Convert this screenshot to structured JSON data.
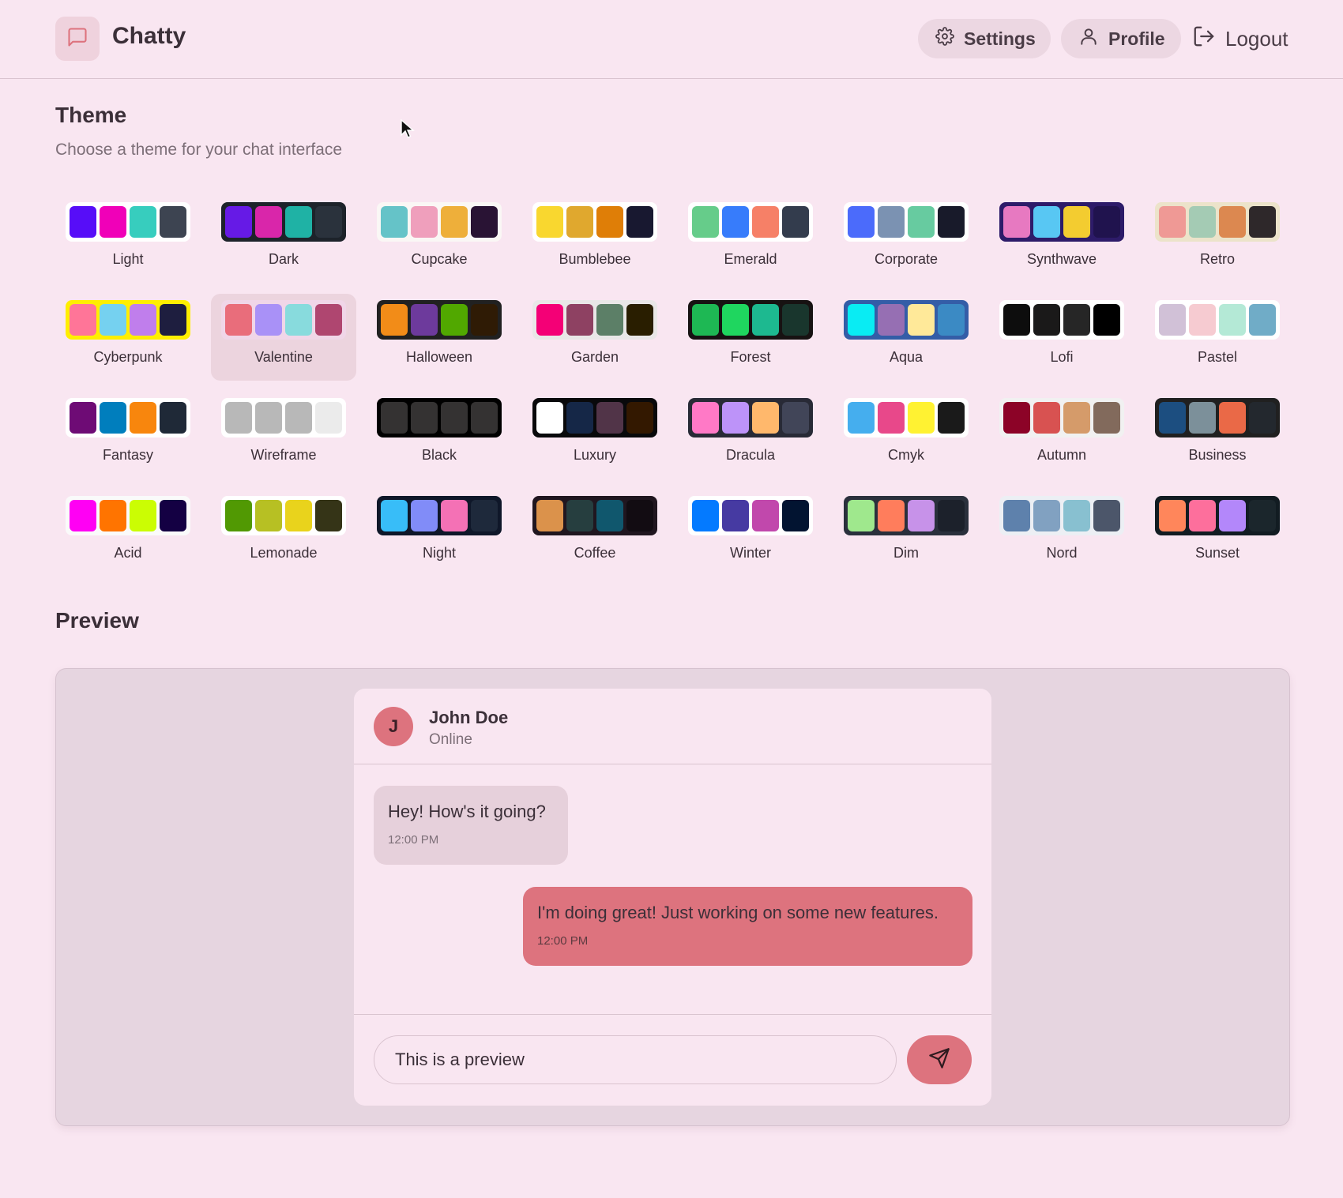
{
  "app": {
    "name": "Chatty",
    "nav": {
      "settings": "Settings",
      "profile": "Profile",
      "logout": "Logout"
    }
  },
  "theme_section": {
    "title": "Theme",
    "subtitle": "Choose a theme for your chat interface",
    "selected": "Valentine",
    "themes": [
      {
        "name": "Light",
        "frame": "#ffffff",
        "colors": [
          "#570df8",
          "#f000b8",
          "#37cdbe",
          "#3d4451"
        ]
      },
      {
        "name": "Dark",
        "frame": "#1d232a",
        "colors": [
          "#661ae6",
          "#d926aa",
          "#1fb2a5",
          "#2a323c"
        ]
      },
      {
        "name": "Cupcake",
        "frame": "#faf7f5",
        "colors": [
          "#65c3c8",
          "#ef9fbc",
          "#eeaf3a",
          "#291334"
        ]
      },
      {
        "name": "Bumblebee",
        "frame": "#ffffff",
        "colors": [
          "#f9d72f",
          "#e0a82e",
          "#df7e07",
          "#181830"
        ]
      },
      {
        "name": "Emerald",
        "frame": "#ffffff",
        "colors": [
          "#66cc8a",
          "#377cfb",
          "#f68067",
          "#333c4d"
        ]
      },
      {
        "name": "Corporate",
        "frame": "#ffffff",
        "colors": [
          "#4b6bfb",
          "#7b92b2",
          "#67cba0",
          "#181a2a"
        ]
      },
      {
        "name": "Synthwave",
        "frame": "#2d1b69",
        "colors": [
          "#e779c1",
          "#58c7f3",
          "#f3cc30",
          "#20134e"
        ]
      },
      {
        "name": "Retro",
        "frame": "#ece3ca",
        "colors": [
          "#ef9995",
          "#a4cbb4",
          "#dc8850",
          "#2e282a"
        ]
      },
      {
        "name": "Cyberpunk",
        "frame": "#ffee00",
        "colors": [
          "#ff7598",
          "#75d1f0",
          "#c07eec",
          "#1e1e3f"
        ]
      },
      {
        "name": "Valentine",
        "frame": "#f0d6e8",
        "colors": [
          "#e96d7b",
          "#a991f7",
          "#88dbdd",
          "#af4670"
        ]
      },
      {
        "name": "Halloween",
        "frame": "#212121",
        "colors": [
          "#f28c18",
          "#6d3a9c",
          "#51a800",
          "#2f1b05"
        ]
      },
      {
        "name": "Garden",
        "frame": "#e9e7e7",
        "colors": [
          "#f40076",
          "#8e4162",
          "#5c7f67",
          "#291e00"
        ]
      },
      {
        "name": "Forest",
        "frame": "#171212",
        "colors": [
          "#1eb854",
          "#1fd65f",
          "#1db990",
          "#19362d"
        ]
      },
      {
        "name": "Aqua",
        "frame": "#345da7",
        "colors": [
          "#09ecf3",
          "#966fb3",
          "#ffe999",
          "#3b8ac4"
        ]
      },
      {
        "name": "Lofi",
        "frame": "#ffffff",
        "colors": [
          "#0d0d0d",
          "#1a1919",
          "#262626",
          "#000000"
        ]
      },
      {
        "name": "Pastel",
        "frame": "#ffffff",
        "colors": [
          "#d1c1d7",
          "#f6cbd1",
          "#b4e9d6",
          "#70acc7"
        ]
      },
      {
        "name": "Fantasy",
        "frame": "#ffffff",
        "colors": [
          "#6e0b75",
          "#007ebd",
          "#f8860d",
          "#1f2937"
        ]
      },
      {
        "name": "Wireframe",
        "frame": "#ffffff",
        "colors": [
          "#b8b8b8",
          "#b8b8b8",
          "#b8b8b8",
          "#ebebeb"
        ]
      },
      {
        "name": "Black",
        "frame": "#000000",
        "colors": [
          "#343232",
          "#343232",
          "#343232",
          "#343232"
        ]
      },
      {
        "name": "Luxury",
        "frame": "#09090b",
        "colors": [
          "#ffffff",
          "#152747",
          "#513448",
          "#331800"
        ]
      },
      {
        "name": "Dracula",
        "frame": "#282a36",
        "colors": [
          "#ff79c6",
          "#bd93f9",
          "#ffb86c",
          "#414558"
        ]
      },
      {
        "name": "Cmyk",
        "frame": "#ffffff",
        "colors": [
          "#45aeee",
          "#e8488a",
          "#fff232",
          "#1a1a1a"
        ]
      },
      {
        "name": "Autumn",
        "frame": "#f1f1f1",
        "colors": [
          "#8c0327",
          "#d85251",
          "#d59b6a",
          "#826a5c"
        ]
      },
      {
        "name": "Business",
        "frame": "#202020",
        "colors": [
          "#1c4e80",
          "#7c909a",
          "#ea6947",
          "#23282e"
        ]
      },
      {
        "name": "Acid",
        "frame": "#fafafa",
        "colors": [
          "#ff00f4",
          "#ff7400",
          "#cbfd03",
          "#140043"
        ]
      },
      {
        "name": "Lemonade",
        "frame": "#ffffff",
        "colors": [
          "#519903",
          "#b7c023",
          "#e9d31c",
          "#353417"
        ]
      },
      {
        "name": "Night",
        "frame": "#0f1729",
        "colors": [
          "#38bdf8",
          "#818cf8",
          "#f471b5",
          "#1e293b"
        ]
      },
      {
        "name": "Coffee",
        "frame": "#20161f",
        "colors": [
          "#db924b",
          "#263e3f",
          "#10576d",
          "#120c12"
        ]
      },
      {
        "name": "Winter",
        "frame": "#ffffff",
        "colors": [
          "#047aff",
          "#463aa2",
          "#c148ac",
          "#021431"
        ]
      },
      {
        "name": "Dim",
        "frame": "#2a303c",
        "colors": [
          "#9fe88d",
          "#ff7d5c",
          "#c792e9",
          "#1c212b"
        ]
      },
      {
        "name": "Nord",
        "frame": "#eceff4",
        "colors": [
          "#5e81ac",
          "#81a1c1",
          "#88c0d0",
          "#4c566a"
        ]
      },
      {
        "name": "Sunset",
        "frame": "#121c22",
        "colors": [
          "#ff865b",
          "#fd6f9c",
          "#b387fa",
          "#1b262c"
        ]
      }
    ]
  },
  "preview_section": {
    "title": "Preview",
    "contact": {
      "initial": "J",
      "name": "John Doe",
      "status": "Online"
    },
    "messages": [
      {
        "text": "Hey! How's it going?",
        "time": "12:00 PM",
        "sent": false
      },
      {
        "text": "I'm doing great! Just working on some new features.",
        "time": "12:00 PM",
        "sent": true
      }
    ],
    "input_value": "This is a preview"
  },
  "colors": {
    "primary": "#dd737e",
    "background": "#f9e6f1",
    "surface": "#e6d5e0"
  },
  "icons": {
    "logo": "message-square-icon",
    "settings": "gear-icon",
    "profile": "user-icon",
    "logout": "logout-icon",
    "send": "send-icon"
  }
}
